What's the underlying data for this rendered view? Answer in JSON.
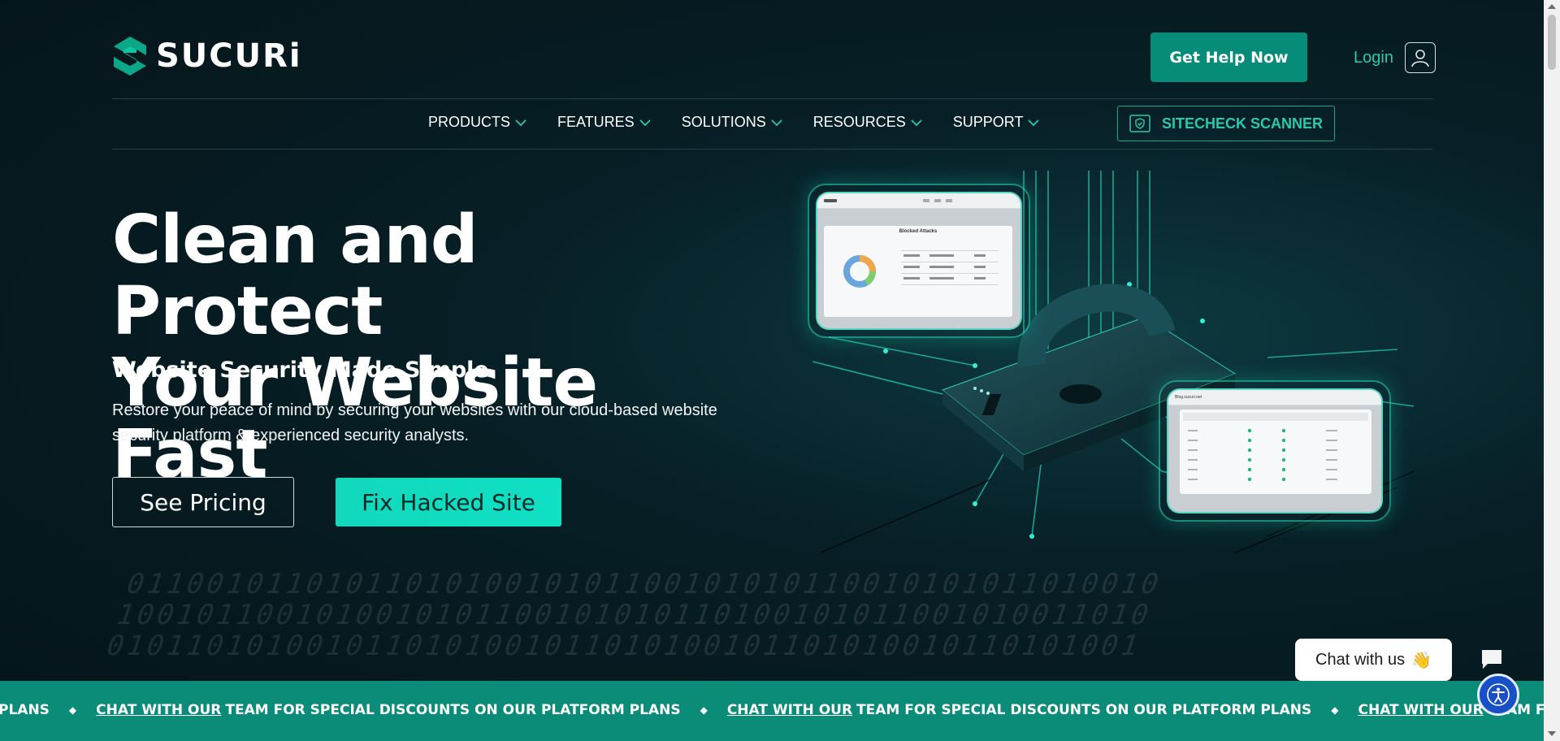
{
  "header": {
    "logo_text": "SUCURi",
    "help_button": "Get Help Now",
    "login_label": "Login"
  },
  "nav": {
    "items": [
      {
        "label": "PRODUCTS"
      },
      {
        "label": "FEATURES"
      },
      {
        "label": "SOLUTIONS"
      },
      {
        "label": "RESOURCES"
      },
      {
        "label": "SUPPORT"
      }
    ],
    "sitecheck_label": "SITECHECK SCANNER"
  },
  "hero": {
    "title_line1": "Clean and Protect",
    "title_line2": "Your Website Fast",
    "subtitle": "Website Security Made Simple.",
    "description": "Restore your peace of mind by securing your websites with our cloud-based website security platform & experienced security analysts.",
    "pricing_button": "See Pricing",
    "fix_button": "Fix Hacked Site"
  },
  "illustration": {
    "panel1_title": "Blocked Attacks",
    "panel2_title": "Blog.sucuri.net"
  },
  "ticker": {
    "lead": "PLANS",
    "link": "CHAT WITH OUR",
    "text": "TEAM FOR SPECIAL DISCOUNTS ON OUR PLATFORM PLANS",
    "tail_text": "TEAM FOR SPECIAL DISCOUNTS ON OU"
  },
  "chat": {
    "label": "Chat with us",
    "emoji": "👋"
  },
  "colors": {
    "background": "#061a20",
    "brand_teal": "#068c79",
    "accent": "#12d8bc",
    "link": "#2bc8ae"
  }
}
